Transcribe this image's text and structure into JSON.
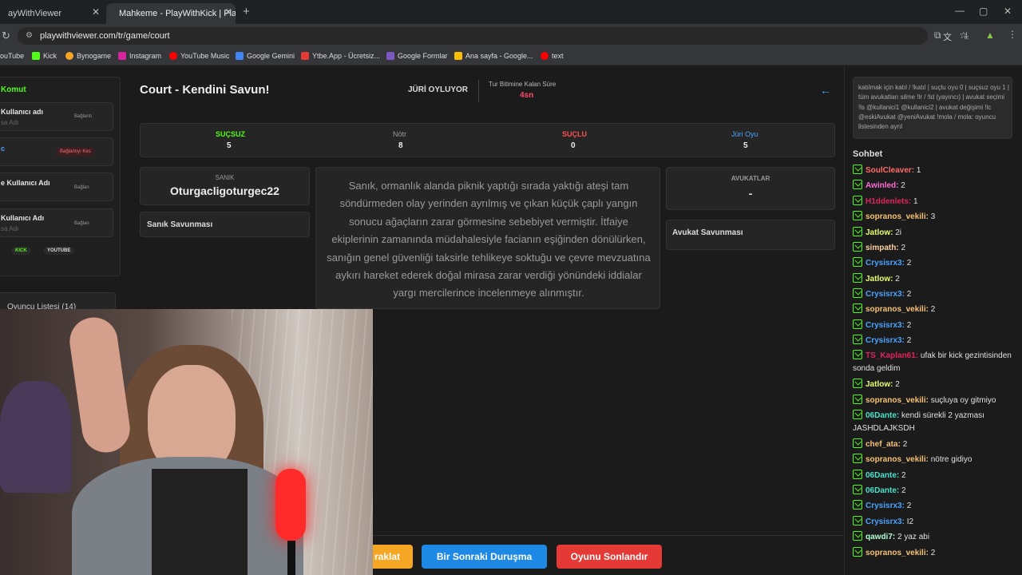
{
  "browser": {
    "tabs": [
      {
        "label": "ayWithViewer"
      },
      {
        "label": "Mahkeme - PlayWithKick | Play"
      }
    ],
    "url": "playwithviewer.com/tr/game/court",
    "bookmarks": [
      "ouTube",
      "Kick",
      "Bynogame",
      "Instagram",
      "YouTube Music",
      "Google Gemini",
      "Ytbe.App - Ücretsiz...",
      "Google Formlar",
      "Ana sayfa - Google...",
      "text"
    ]
  },
  "left": {
    "title": "Komut",
    "rows": [
      {
        "label": "Kullanıcı adı",
        "sub": "sa Adı",
        "status": "Bağlantı"
      },
      {
        "label": "c",
        "sub": "",
        "status": "Bağlantıyı Kes"
      },
      {
        "label": "e Kullanıcı Adı",
        "sub": "",
        "status": "Bağlan"
      },
      {
        "label": "Kullanıcı Adı",
        "sub": "sa Adı",
        "status": "Bağlan"
      }
    ],
    "platforms": [
      "KICK",
      "YOUTUBE"
    ],
    "player_list": "Oyuncu Listesi (14)"
  },
  "court": {
    "title": "Court - Kendini Savun!",
    "phase": "JÜRİ OYLUYOR",
    "timer_label": "Tur Bitimine Kalan Süre",
    "timer_value": "4sn",
    "votes": [
      {
        "label": "SUÇSUZ",
        "value": "5",
        "color": "#53fc18"
      },
      {
        "label": "Nötr",
        "value": "8",
        "color": "#999999"
      },
      {
        "label": "SUÇLU",
        "value": "0",
        "color": "#ff4d4d"
      },
      {
        "label": "Jüri Oyu",
        "value": "5",
        "color": "#4aa3ff"
      }
    ],
    "defendant_label": "SANIK",
    "defendant_name": "Oturgacligoturgec22",
    "defense_title": "Sanık Savunması",
    "case_text": "Sanık, ormanlık alanda piknik yaptığı sırada yaktığı ateşi tam söndürmeden olay yerinden ayrılmış ve çıkan küçük çaplı yangın sonucu ağaçların zarar görmesine sebebiyet vermiştir. İtfaiye ekiplerinin zamanında müdahalesiyle facianın eşiğinden dönülürken, sanığın genel güvenliği taksirle tehlikeye soktuğu ve çevre mevzuatına aykırı hareket ederek doğal mirasa zarar verdiği yönündeki iddialar yargı mercilerince incelenmeye alınmıştır.",
    "lawyers_label": "AVUKATLAR",
    "lawyers_value": "-",
    "lawyer_defense": "Avukat Savunması",
    "buttons": [
      {
        "label": "raklat",
        "color": "#f5a623"
      },
      {
        "label": "Bir Sonraki Duruşma",
        "color": "#1e88e5"
      },
      {
        "label": "Oyunu Sonlandır",
        "color": "#e53935"
      }
    ]
  },
  "chat": {
    "info": "katılmak için katıl / !katıl | suçlu oyu 0 | suçsuz oyu 1 | tüm avukatları silme !lr / !ld (yayıncı) | avukat seçimi !ls @kullanici1 @kullanici2 | avukat değişimi !lc @eskiAvukat @yeniAvukat !mola / mola: oyuncu listesinden ayrıl",
    "title": "Sohbet",
    "messages": [
      {
        "user": "SoulCleaver:",
        "text": "1",
        "color": "#ff6b6b"
      },
      {
        "user": "Awinled:",
        "text": "2",
        "color": "#ff6bd6"
      },
      {
        "user": "H1ddenlets:",
        "text": "1",
        "color": "#e0245e"
      },
      {
        "user": "sopranos_vekili:",
        "text": "3",
        "color": "#f6c177"
      },
      {
        "user": "Jatlow:",
        "text": "2i",
        "color": "#e9ff70"
      },
      {
        "user": "simpath:",
        "text": "2",
        "color": "#ffd1a1"
      },
      {
        "user": "Crysisrx3:",
        "text": "2",
        "color": "#4aa3ff"
      },
      {
        "user": "Jatlow:",
        "text": "2",
        "color": "#e9ff70"
      },
      {
        "user": "Crysisrx3:",
        "text": "2",
        "color": "#4aa3ff"
      },
      {
        "user": "sopranos_vekili:",
        "text": "2",
        "color": "#f6c177"
      },
      {
        "user": "Crysisrx3:",
        "text": "2",
        "color": "#4aa3ff"
      },
      {
        "user": "Crysisrx3:",
        "text": "2",
        "color": "#4aa3ff"
      },
      {
        "user": "TS_Kaplan61:",
        "text": "ufak bir kick gezintisinden sonda geldim",
        "color": "#e0245e"
      },
      {
        "user": "Jatlow:",
        "text": "2",
        "color": "#e9ff70"
      },
      {
        "user": "sopranos_vekili:",
        "text": "suçluya oy gitmiyo",
        "color": "#f6c177"
      },
      {
        "user": "06Dante:",
        "text": "kendi sürekli 2 yazması JASHDLAJKSDH",
        "color": "#4de0c9"
      },
      {
        "user": "chef_ata:",
        "text": "2",
        "color": "#f6c177"
      },
      {
        "user": "sopranos_vekili:",
        "text": "nötre gidiyo",
        "color": "#f6c177"
      },
      {
        "user": "06Dante:",
        "text": "2",
        "color": "#4de0c9"
      },
      {
        "user": "06Dante:",
        "text": "2",
        "color": "#4de0c9"
      },
      {
        "user": "Crysisrx3:",
        "text": "2",
        "color": "#4aa3ff"
      },
      {
        "user": "Crysisrx3:",
        "text": "I2",
        "color": "#4aa3ff"
      },
      {
        "user": "qawdi7:",
        "text": "2 yaz abi",
        "color": "#b3ffd9"
      },
      {
        "user": "sopranos_vekili:",
        "text": "2",
        "color": "#f6c177"
      }
    ]
  }
}
